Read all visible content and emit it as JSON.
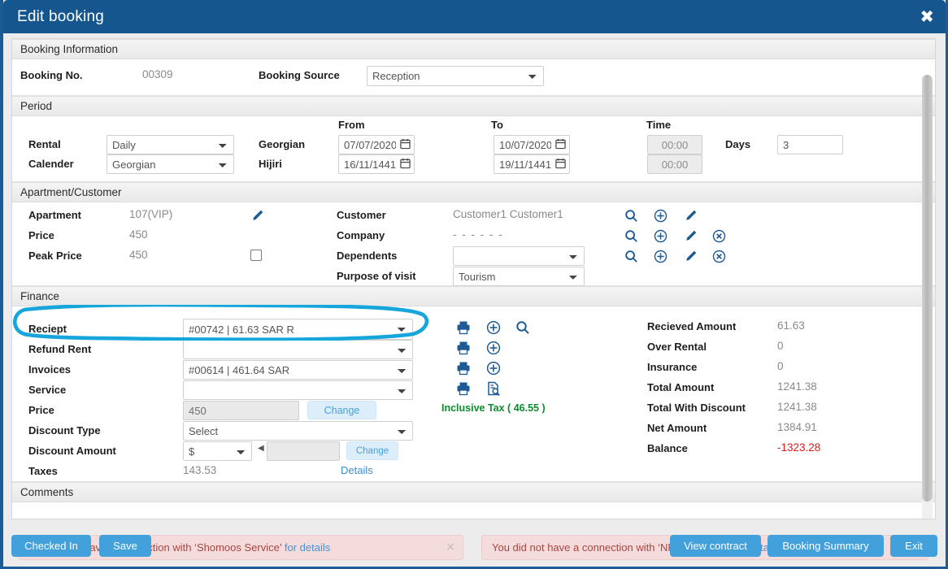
{
  "window": {
    "title": "Edit booking",
    "close_icon": "close-icon"
  },
  "booking_information": {
    "header": "Booking Information",
    "booking_no_label": "Booking No.",
    "booking_no_value": "00309",
    "booking_source_label": "Booking Source",
    "booking_source_value": "Reception",
    "booking_source_options": [
      "Reception"
    ]
  },
  "period": {
    "header": "Period",
    "col_from": "From",
    "col_to": "To",
    "col_time": "Time",
    "rental_label": "Rental",
    "rental_value": "Daily",
    "rental_options": [
      "Daily"
    ],
    "calender_label": "Calender",
    "calender_value": "Georgian",
    "calender_options": [
      "Georgian"
    ],
    "georgian_label": "Georgian",
    "hijiri_label": "Hijiri",
    "georgian_from": "07/07/2020",
    "georgian_to": "10/07/2020",
    "hijiri_from": "16/11/1441",
    "hijiri_to": "19/11/1441",
    "time_from": "00:00",
    "time_to": "00:00",
    "days_label": "Days",
    "days_value": "3"
  },
  "apartment_customer": {
    "header": "Apartment/Customer",
    "apartment_label": "Apartment",
    "apartment_value": "107(VIP)",
    "price_label": "Price",
    "price_value": "450",
    "peak_price_label": "Peak Price",
    "peak_price_value": "450",
    "customer_label": "Customer",
    "customer_value": "Customer1 Customer1",
    "company_label": "Company",
    "company_value": "- - - - - -",
    "dependents_label": "Dependents",
    "dependents_value": "",
    "purpose_label": "Purpose of visit",
    "purpose_value": "Tourism",
    "purpose_options": [
      "Tourism"
    ]
  },
  "finance": {
    "header": "Finance",
    "reciept_label": "Reciept",
    "reciept_value": "#00742 | 61.63 SAR R",
    "reciept_options": [
      "#00742 | 61.63 SAR R"
    ],
    "refund_rent_label": "Refund Rent",
    "refund_rent_value": "",
    "invoices_label": "Invoices",
    "invoices_value": "#00614 | 461.64 SAR",
    "invoices_options": [
      "#00614 | 461.64 SAR"
    ],
    "service_label": "Service",
    "service_value": "",
    "price_label": "Price",
    "price_value": "450",
    "price_change_label": "Change",
    "discount_type_label": "Discount Type",
    "discount_type_value": "Select",
    "discount_type_options": [
      "Select"
    ],
    "discount_amount_label": "Discount Amount",
    "discount_currency_value": "$",
    "discount_currency_options": [
      "$"
    ],
    "discount_amount_value": "",
    "discount_change_label": "Change",
    "taxes_label": "Taxes",
    "taxes_value": "143.53",
    "taxes_details_link": "Details",
    "inclusive_tax": "Inclusive Tax ( 46.55 )",
    "totals": [
      {
        "label": "Recieved Amount",
        "value": "61.63",
        "negative": false
      },
      {
        "label": "Over Rental",
        "value": "0",
        "negative": false
      },
      {
        "label": "Insurance",
        "value": "0",
        "negative": false
      },
      {
        "label": "Total Amount",
        "value": "1241.38",
        "negative": false
      },
      {
        "label": "Total With Discount",
        "value": "1241.38",
        "negative": false
      },
      {
        "label": "Net Amount",
        "value": "1384.91",
        "negative": false
      },
      {
        "label": "Balance",
        "value": "-1323.28",
        "negative": true
      }
    ]
  },
  "comments": {
    "header": "Comments",
    "alerts": [
      {
        "text": "You did not have a connection with ‘Shomoos Service’",
        "link": "for details",
        "close": "×"
      },
      {
        "text": "You did not have a connection with ‘NPTM Service’",
        "link": "for details",
        "close": "×"
      }
    ]
  },
  "footer": {
    "checked_in": "Checked In",
    "save": "Save",
    "view_contract": "View contract",
    "booking_summary": "Booking Summary",
    "exit": "Exit"
  },
  "colors": {
    "title_bar": "#15568f",
    "button_blue": "#42a0db",
    "annotation": "#16a6dc",
    "negative": "#e01b1b",
    "inclusive_tax": "#0f8a2f"
  }
}
